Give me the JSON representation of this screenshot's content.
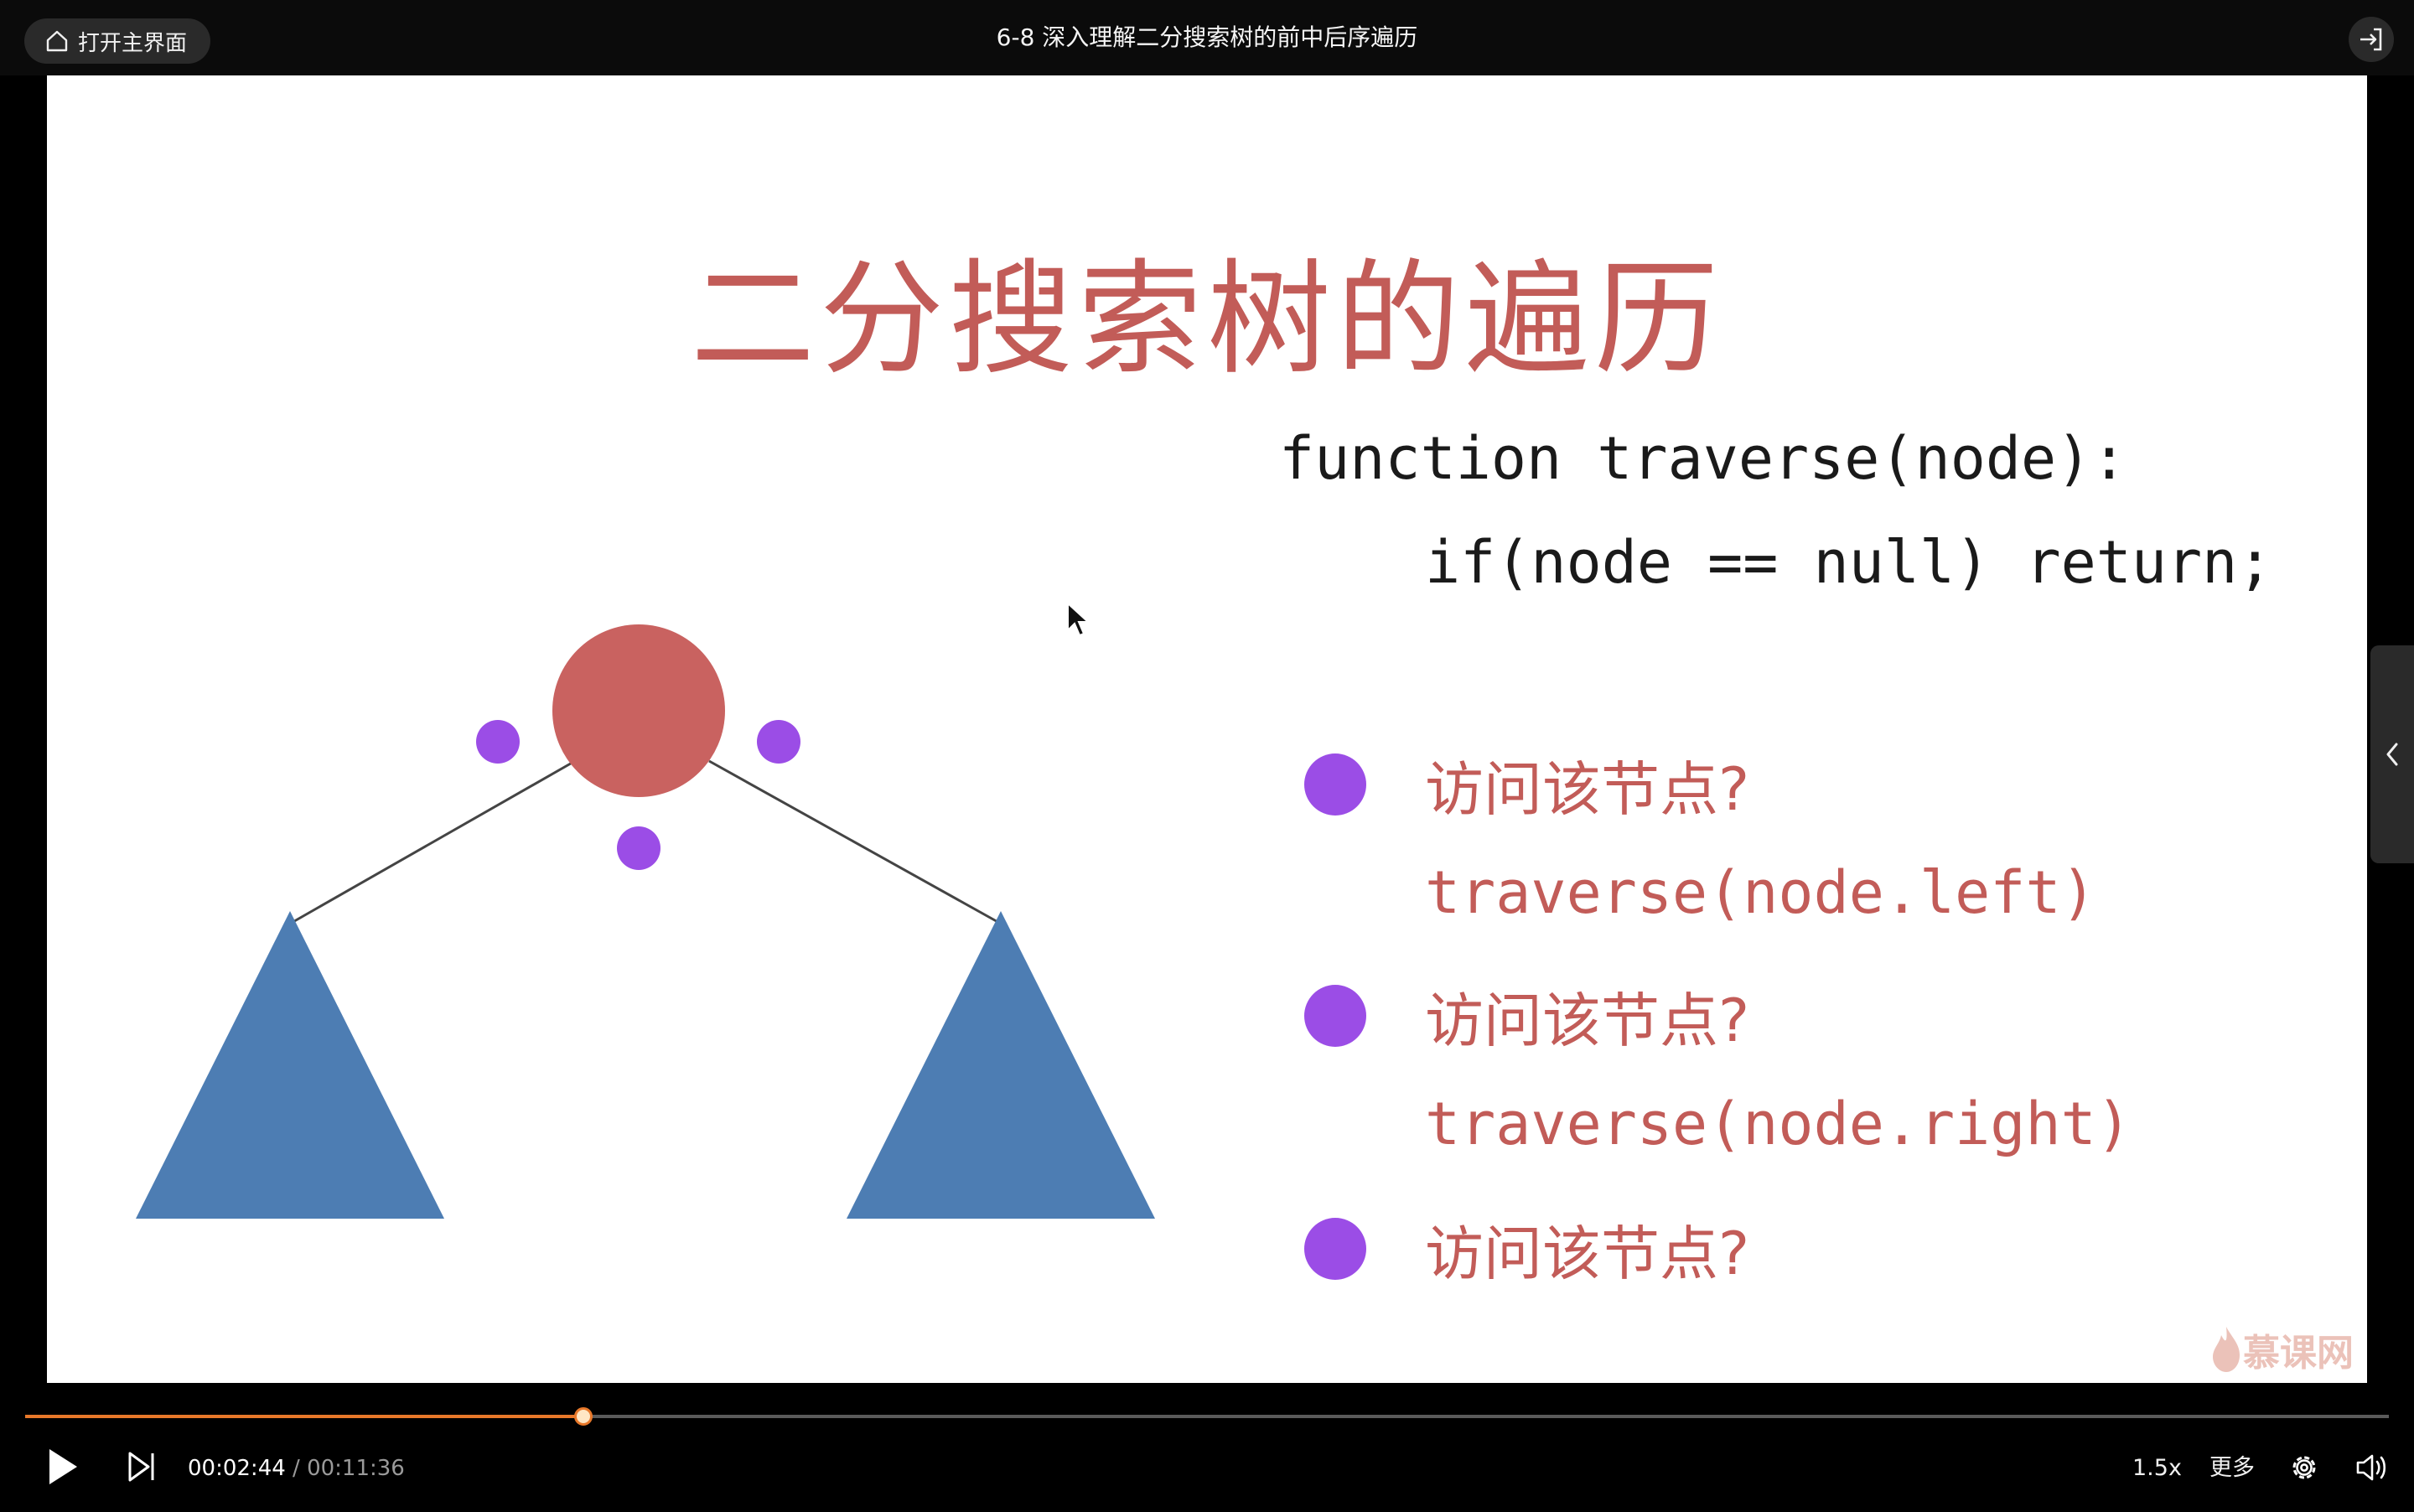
{
  "topbar": {
    "home_label": "打开主界面",
    "video_title": "6-8 深入理解二分搜索树的前中后序遍历"
  },
  "slide": {
    "title": "二分搜索树的遍历",
    "code_line_1": "function traverse(node):",
    "code_line_2": "if(node == null) return;",
    "steps": [
      {
        "kind": "visit",
        "text": "访问该节点?"
      },
      {
        "kind": "code",
        "text": "traverse(node.left)"
      },
      {
        "kind": "visit",
        "text": "访问该节点?"
      },
      {
        "kind": "code",
        "text": "traverse(node.right)"
      },
      {
        "kind": "visit",
        "text": "访问该节点?"
      }
    ],
    "watermark": "慕课网",
    "colors": {
      "title": "#c25c58",
      "root_node": "#c96260",
      "visit_dot": "#9b4de6",
      "subtree": "#4d7db3"
    }
  },
  "player": {
    "current_time": "00:02:44",
    "separator": " / ",
    "total_time": "00:11:36",
    "progress": 0.2362,
    "speed_label": "1.5x",
    "more_label": "更多",
    "accent": "#e8782a"
  }
}
